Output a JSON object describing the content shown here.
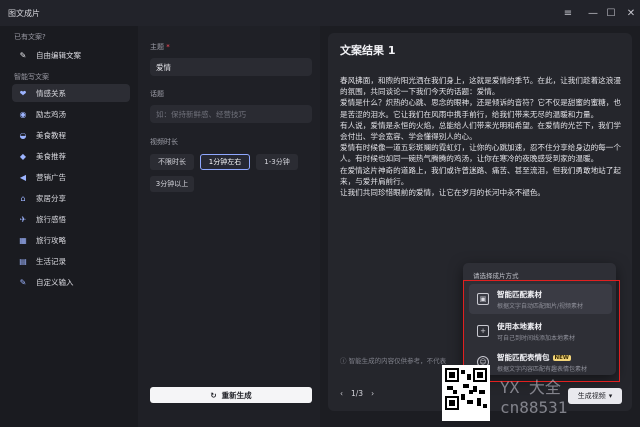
{
  "window": {
    "title": "图文成片"
  },
  "sidebar": {
    "section1_label": "已有文案?",
    "free_edit": "自由编辑文案",
    "section2_label": "智能写文案",
    "items": [
      {
        "label": "情感关系"
      },
      {
        "label": "励志鸡汤"
      },
      {
        "label": "美食教程"
      },
      {
        "label": "美食推荐"
      },
      {
        "label": "营销广告"
      },
      {
        "label": "家居分享"
      },
      {
        "label": "旅行感悟"
      },
      {
        "label": "旅行攻略"
      },
      {
        "label": "生活记录"
      },
      {
        "label": "自定义输入"
      }
    ]
  },
  "form": {
    "theme_label": "主题",
    "theme_value": "爱情",
    "topic_label": "话题",
    "topic_placeholder": "如：保持新鲜感、经营技巧",
    "duration_label": "视频时长",
    "durations": [
      "不限时长",
      "1分钟左右",
      "1-3分钟",
      "3分钟以上"
    ],
    "regenerate": "重新生成"
  },
  "result": {
    "title": "文案结果 1",
    "paragraphs": [
      "春风拂面，和煦的阳光洒在我们身上，这就是爱情的季节。在此，让我们趁着这浪漫的氛围，共同谈论一下我们今天的话题：爱情。",
      "爱情是什么？炽热的心跳、思念的眼神，还是倾诉的音符？它不仅是甜蜜的蜜糖，也是苦涩的泪水。它让我们在风雨中携手前行，给我们带来无尽的温暖和力量。",
      "有人说，爱情是永恒的火焰，总能给人们带来光明和希望。在爱情的光芒下，我们学会付出、学会宽容、学会懂得别人的心。",
      "爱情有时候像一道五彩斑斓的霓虹灯，让你的心跳加速，忍不住分享给身边的每一个人。有时候也如同一碗热气腾腾的鸡汤，让你在寒冷的夜晚感受到家的温暖。",
      "在爱情这片神奇的道路上，我们或许曾迷路、痛苦、甚至流泪，但我们勇敢地站了起来，与爱并肩前行。",
      "让我们共同珍惜眼前的爱情，让它在岁月的长河中永不褪色。"
    ],
    "notice": "智能生成的内容仅供参考，不代表",
    "pager": "1/3"
  },
  "popup": {
    "title": "请选择成片方式",
    "options": [
      {
        "title": "智能匹配素材",
        "subtitle": "根据文字自动匹配图片/视频素材"
      },
      {
        "title": "使用本地素材",
        "subtitle": "可自己到时间线添加本地素材"
      },
      {
        "title": "智能匹配表情包",
        "badge": "NEW",
        "subtitle": "根据文字内容匹配有趣表情包素材"
      }
    ]
  },
  "bottom": {
    "smart_btn": "生成视频"
  },
  "watermark": {
    "line1": "YX 大全",
    "line2": "cn88531"
  }
}
